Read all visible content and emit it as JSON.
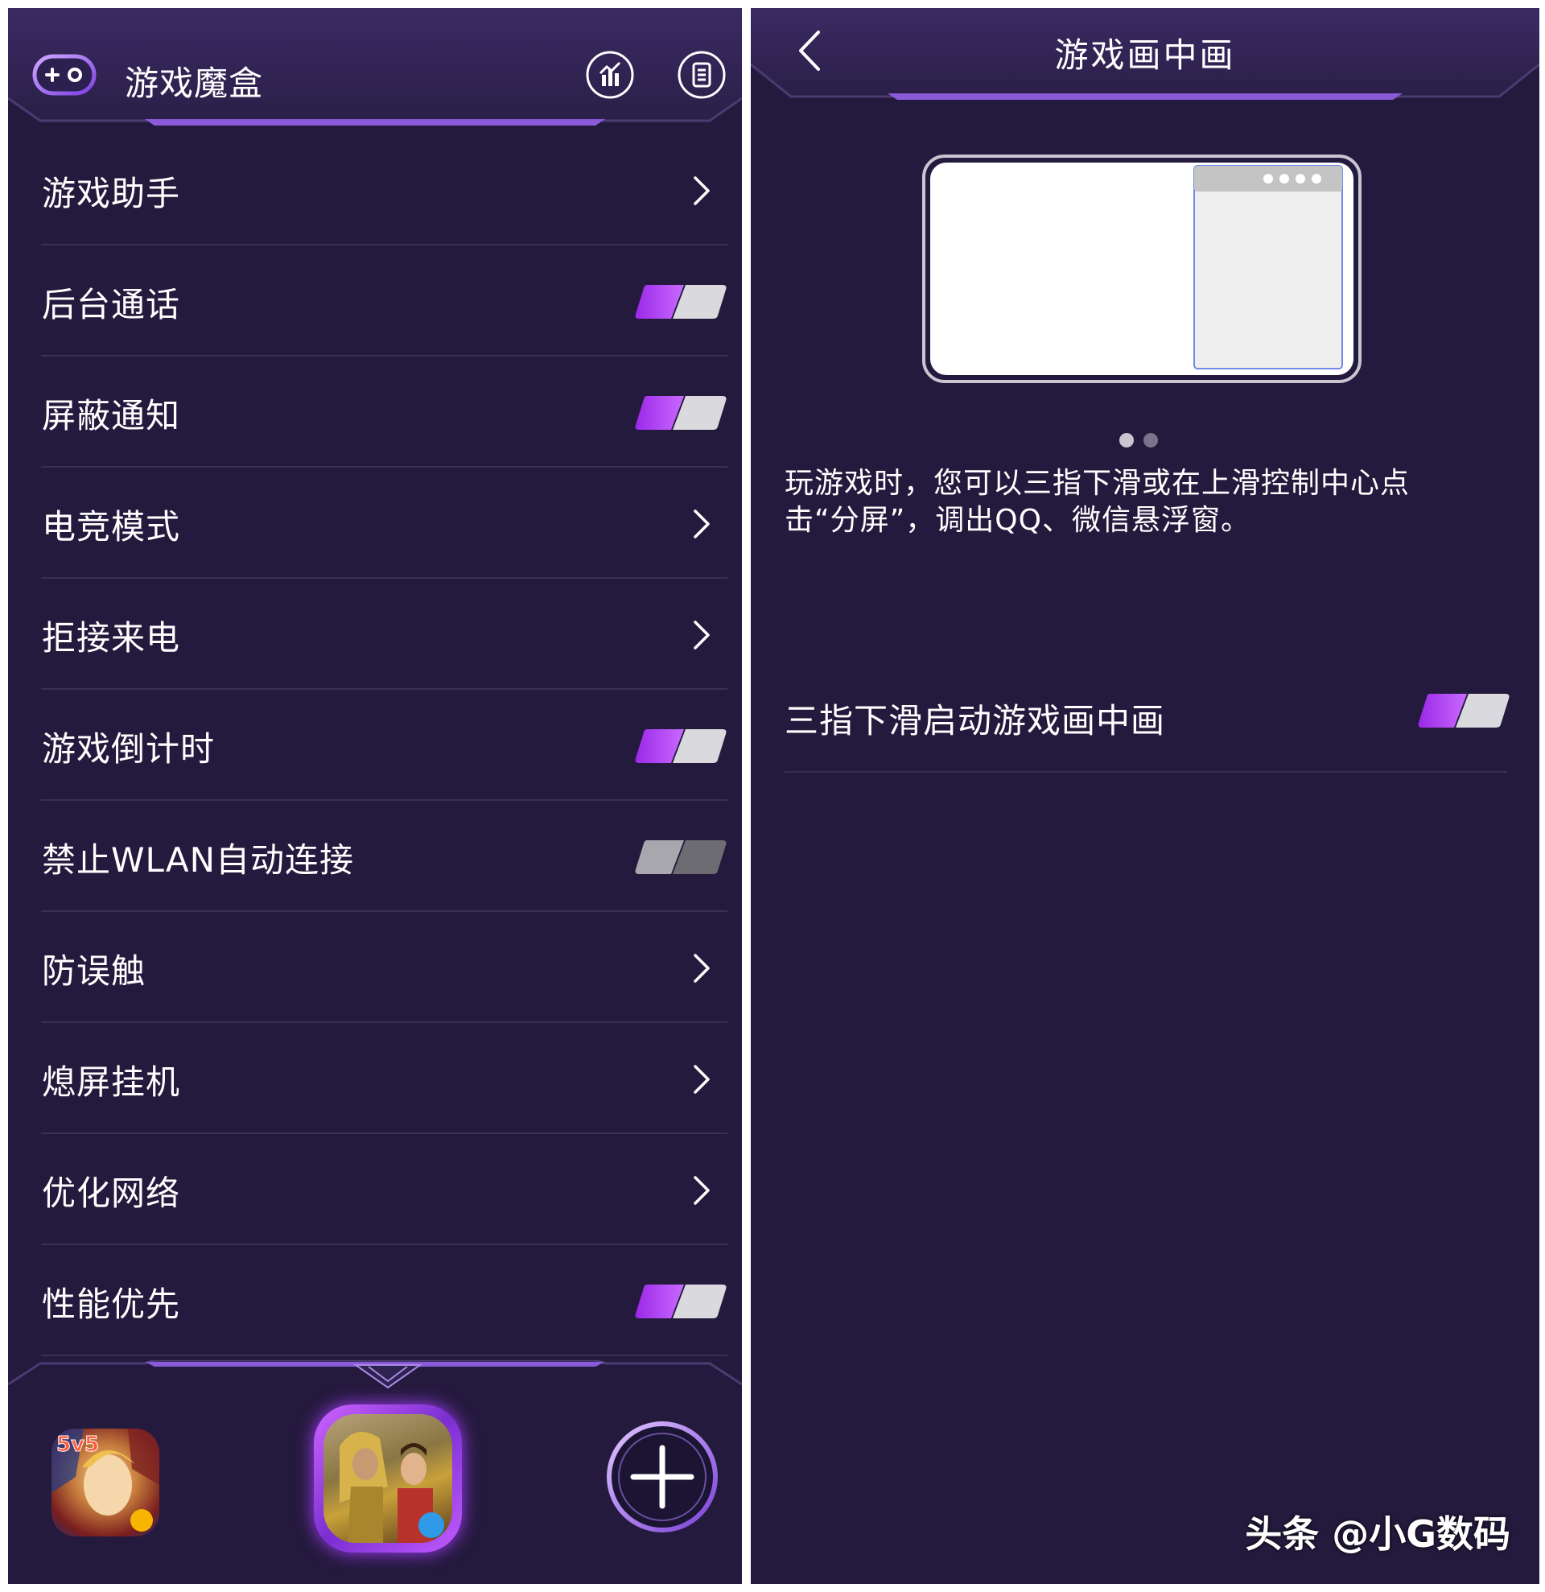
{
  "left": {
    "header": {
      "title": "游戏魔盒"
    },
    "menu": [
      {
        "label": "游戏助手",
        "control": "chevron"
      },
      {
        "label": "后台通话",
        "control": "toggle",
        "on": true
      },
      {
        "label": "屏蔽通知",
        "control": "toggle",
        "on": true
      },
      {
        "label": "电竞模式",
        "control": "chevron"
      },
      {
        "label": "拒接来电",
        "control": "chevron"
      },
      {
        "label": "游戏倒计时",
        "control": "toggle",
        "on": true
      },
      {
        "label": "禁止WLAN自动连接",
        "control": "toggle",
        "on": false
      },
      {
        "label": "防误触",
        "control": "chevron"
      },
      {
        "label": "熄屏挂机",
        "control": "chevron"
      },
      {
        "label": "优化网络",
        "control": "chevron"
      },
      {
        "label": "性能优先",
        "control": "toggle",
        "on": true
      }
    ],
    "dock": {
      "games": [
        "moba-game-icon",
        "battle-royale-game-icon"
      ],
      "add_icon": "plus-icon"
    }
  },
  "right": {
    "header": {
      "title": "游戏画中画"
    },
    "carousel": {
      "current_page": 1,
      "total_pages": 2
    },
    "description": "玩游戏时，您可以三指下滑或在上滑控制中心点击“分屏”，调出QQ、微信悬浮窗。",
    "setting": {
      "label": "三指下滑启动游戏画中画",
      "on": true
    }
  },
  "watermark": "头条 @小G数码",
  "colors": {
    "background": "#241a3d",
    "accent": "#a23cf2",
    "divider": "#3a2f55",
    "text": "#ffffff"
  }
}
